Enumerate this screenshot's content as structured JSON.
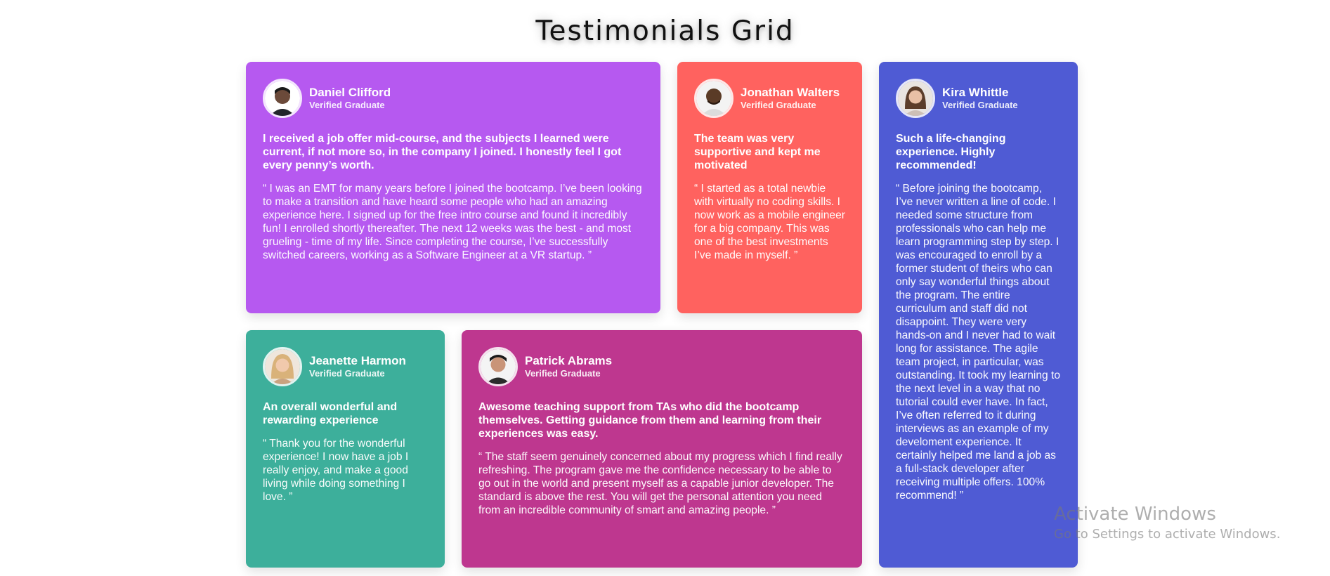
{
  "page": {
    "title": "Testimonials Grid"
  },
  "colors": {
    "violet": "#b659f0",
    "coral": "#ff625f",
    "indigo": "#4f5bd4",
    "teal": "#3daf9b",
    "magenta": "#be378f"
  },
  "testimonials": [
    {
      "name": "Daniel Clifford",
      "role": "Verified Graduate",
      "headline": "I received a job offer mid-course, and the subjects I learned were current, if not more so, in the company I joined. I honestly feel I got every penny’s worth.",
      "quote": "“ I was an EMT for many years before I joined the bootcamp. I’ve been looking to make a transition and have heard some people who had an amazing experience here. I signed up for the free intro course and found it incredibly fun! I enrolled shortly thereafter. The next 12 weeks was the best - and most grueling - time of my life. Since completing the course, I’ve successfully switched careers, working as a Software Engineer at a VR startup. ”",
      "avatar_icon": "avatar-photo-icon"
    },
    {
      "name": "Jonathan Walters",
      "role": "Verified Graduate",
      "headline": "The team was very supportive and kept me motivated",
      "quote": "“ I started as a total newbie with virtually no coding skills. I now work as a mobile engineer for a big company. This was one of the best investments I’ve made in myself. ”",
      "avatar_icon": "avatar-photo-icon"
    },
    {
      "name": "Kira Whittle",
      "role": "Verified Graduate",
      "headline": "Such a life-changing experience. Highly recommended!",
      "quote": "“ Before joining the bootcamp, I’ve never written a line of code. I needed some structure from professionals who can help me learn programming step by step. I was encouraged to enroll by a former student of theirs who can only say wonderful things about the program. The entire curriculum and staff did not disappoint. They were very hands-on and I never had to wait long for assistance. The agile team project, in particular, was outstanding. It took my learning to the next level in a way that no tutorial could ever have. In fact, I’ve often referred to it during interviews as an example of my develoment experience. It certainly helped me land a job as a full-stack developer after receiving multiple offers. 100% recommend! ”",
      "avatar_icon": "avatar-photo-icon"
    },
    {
      "name": "Jeanette Harmon",
      "role": "Verified Graduate",
      "headline": "An overall wonderful and rewarding experience",
      "quote": "“ Thank you for the wonderful experience! I now have a job I really enjoy, and make a good living while doing something I love. ”",
      "avatar_icon": "avatar-photo-icon"
    },
    {
      "name": "Patrick Abrams",
      "role": "Verified Graduate",
      "headline": "Awesome teaching support from TAs who did the bootcamp themselves. Getting guidance from them and learning from their experiences was easy.",
      "quote": "“ The staff seem genuinely concerned about my progress which I find really refreshing. The program gave me the confidence necessary to be able to go out in the world and present myself as a capable junior developer. The standard is above the rest. You will get the personal attention you need from an incredible community of smart and amazing people. ”",
      "avatar_icon": "avatar-photo-icon"
    }
  ],
  "watermark": {
    "title": "Activate Windows",
    "subtitle": "Go to Settings to activate Windows."
  }
}
